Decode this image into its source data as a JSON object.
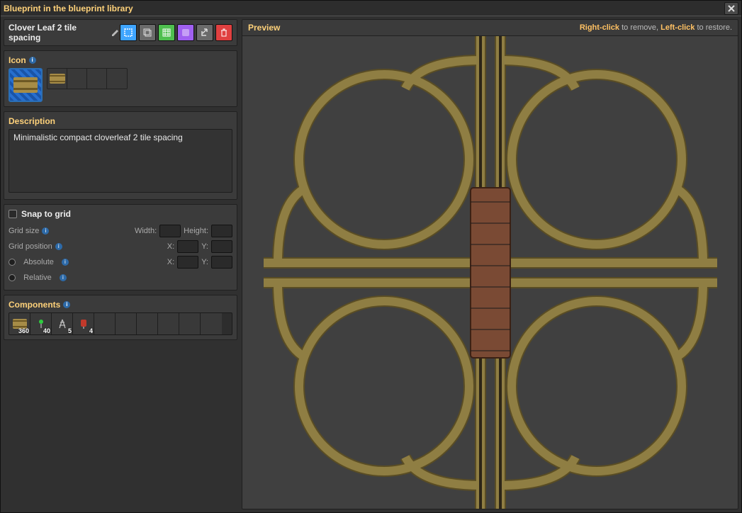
{
  "window": {
    "title": "Blueprint in the blueprint library"
  },
  "blueprint": {
    "name": "Clover Leaf 2 tile spacing",
    "description": "Minimalistic compact cloverleaf 2 tile spacing"
  },
  "toolbar": {
    "select_new_contents": "select-new-contents",
    "reassign": "reassign",
    "grid": "grid-toggle",
    "color": "color",
    "export": "export-string",
    "delete": "delete"
  },
  "sections": {
    "icon": "Icon",
    "description": "Description",
    "snap": "Snap to grid",
    "components": "Components"
  },
  "grid": {
    "size_label": "Grid size",
    "width_label": "Width:",
    "height_label": "Height:",
    "pos_label": "Grid position",
    "x_label": "X:",
    "y_label": "Y:",
    "abs_label": "Absolute",
    "rel_label": "Relative",
    "width": "",
    "height": "",
    "px": "",
    "py": "",
    "ax": "",
    "ay": ""
  },
  "components": [
    {
      "name": "rail",
      "icon": "rail",
      "count": 360
    },
    {
      "name": "rail-signal",
      "icon": "signal",
      "count": 40
    },
    {
      "name": "big-electric-pole",
      "icon": "pole",
      "count": 5
    },
    {
      "name": "rail-chain-signal",
      "icon": "chain",
      "count": 4
    }
  ],
  "preview": {
    "title": "Preview",
    "help_right": "Right-click",
    "help_remove": " to remove, ",
    "help_left": "Left-click",
    "help_restore": " to restore."
  }
}
